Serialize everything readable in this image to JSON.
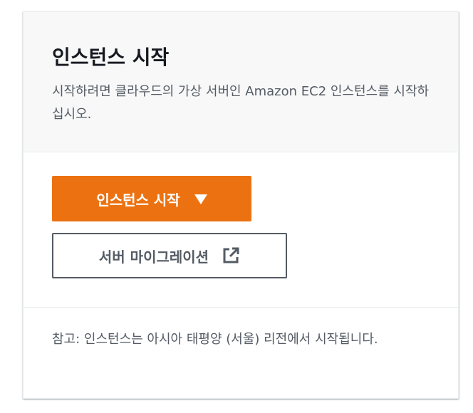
{
  "card": {
    "title": "인스턴스 시작",
    "description": "시작하려면 클라우드의 가상 서버인 Amazon EC2 인스턴스를 시작하십시오.",
    "primary_button": {
      "label": "인스턴스 시작",
      "icon": "caret-down-icon"
    },
    "secondary_button": {
      "label": "서버 마이그레이션",
      "icon": "external-link-icon"
    },
    "note": "참고: 인스턴스는 아시아 태평양 (서울) 리전에서 시작됩니다."
  },
  "colors": {
    "primary": "#ec7211",
    "text": "#16191f",
    "secondary_text": "#545b64",
    "header_bg": "#f8f8f8",
    "border": "#eaeded"
  }
}
